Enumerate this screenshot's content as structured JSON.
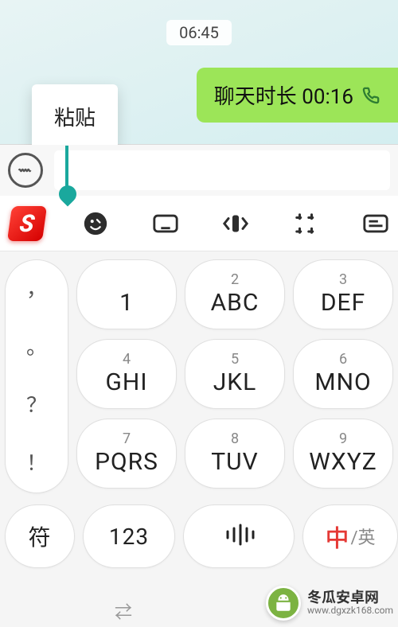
{
  "chat": {
    "timestamp": "06:45",
    "bubble_text": "聊天时长 00:16",
    "paste_label": "粘贴"
  },
  "input": {
    "voice_icon": "voice-wave-icon",
    "value": ""
  },
  "toolbar": {
    "logo_letter": "S",
    "icons": [
      "emoji-icon",
      "keyboard-icon",
      "cursor-move-icon",
      "grid-icon",
      "clipboard-icon"
    ]
  },
  "keyboard": {
    "punct": [
      "，",
      "。",
      "？",
      "！"
    ],
    "rows": [
      [
        {
          "sup": "1",
          "main": "1"
        },
        {
          "sup": "2",
          "main": "ABC"
        },
        {
          "sup": "3",
          "main": "DEF"
        }
      ],
      [
        {
          "sup": "4",
          "main": "GHI"
        },
        {
          "sup": "5",
          "main": "JKL"
        },
        {
          "sup": "6",
          "main": "MNO"
        }
      ],
      [
        {
          "sup": "7",
          "main": "PQRS"
        },
        {
          "sup": "8",
          "main": "TUV"
        },
        {
          "sup": "9",
          "main": "WXYZ"
        }
      ]
    ],
    "bottom": {
      "sym": "符",
      "num": "123",
      "voice": "voice-icon",
      "lang_zh": "中",
      "lang_sep": "/英"
    }
  },
  "watermark": {
    "line1": "冬瓜安卓网",
    "line2": "www.dgxzk168.com"
  }
}
